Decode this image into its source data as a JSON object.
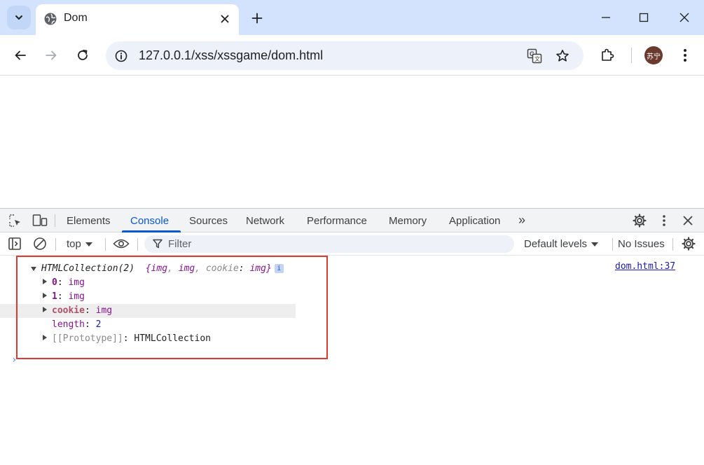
{
  "tab": {
    "title": "Dom"
  },
  "omnibox": {
    "url": "127.0.0.1/xss/xssgame/dom.html"
  },
  "profile": {
    "avatar_text": "苏宁"
  },
  "devtools": {
    "tabs": [
      "Elements",
      "Console",
      "Sources",
      "Network",
      "Performance",
      "Memory",
      "Application"
    ],
    "active_tab": "Console",
    "more_tabs": "»",
    "context": "top",
    "filter_placeholder": "Filter",
    "levels": "Default levels",
    "issues": "No Issues"
  },
  "console": {
    "source_link": "dom.html:37",
    "summary": {
      "type": "HTMLCollection(2)",
      "open": "{",
      "item1": "img",
      "item2": "img",
      "sep": ", ",
      "cookie_key": "cookie",
      "colon": ": ",
      "cookie_val": "img",
      "close": "}",
      "info": "i"
    },
    "rows": {
      "r0_key": "0",
      "r0_val": "img",
      "r1_key": "1",
      "r1_val": "img",
      "r2_key": "cookie",
      "r2_val": "img",
      "length_key": "length",
      "length_val": "2",
      "proto_key": "[[Prototype]]",
      "proto_val": "HTMLCollection",
      "colon": ": "
    },
    "prompt": "›"
  },
  "colors": {
    "tabstrip_bg": "#d3e3fd",
    "accent": "#0b57d0",
    "highlight_border": "#e03a2f"
  }
}
